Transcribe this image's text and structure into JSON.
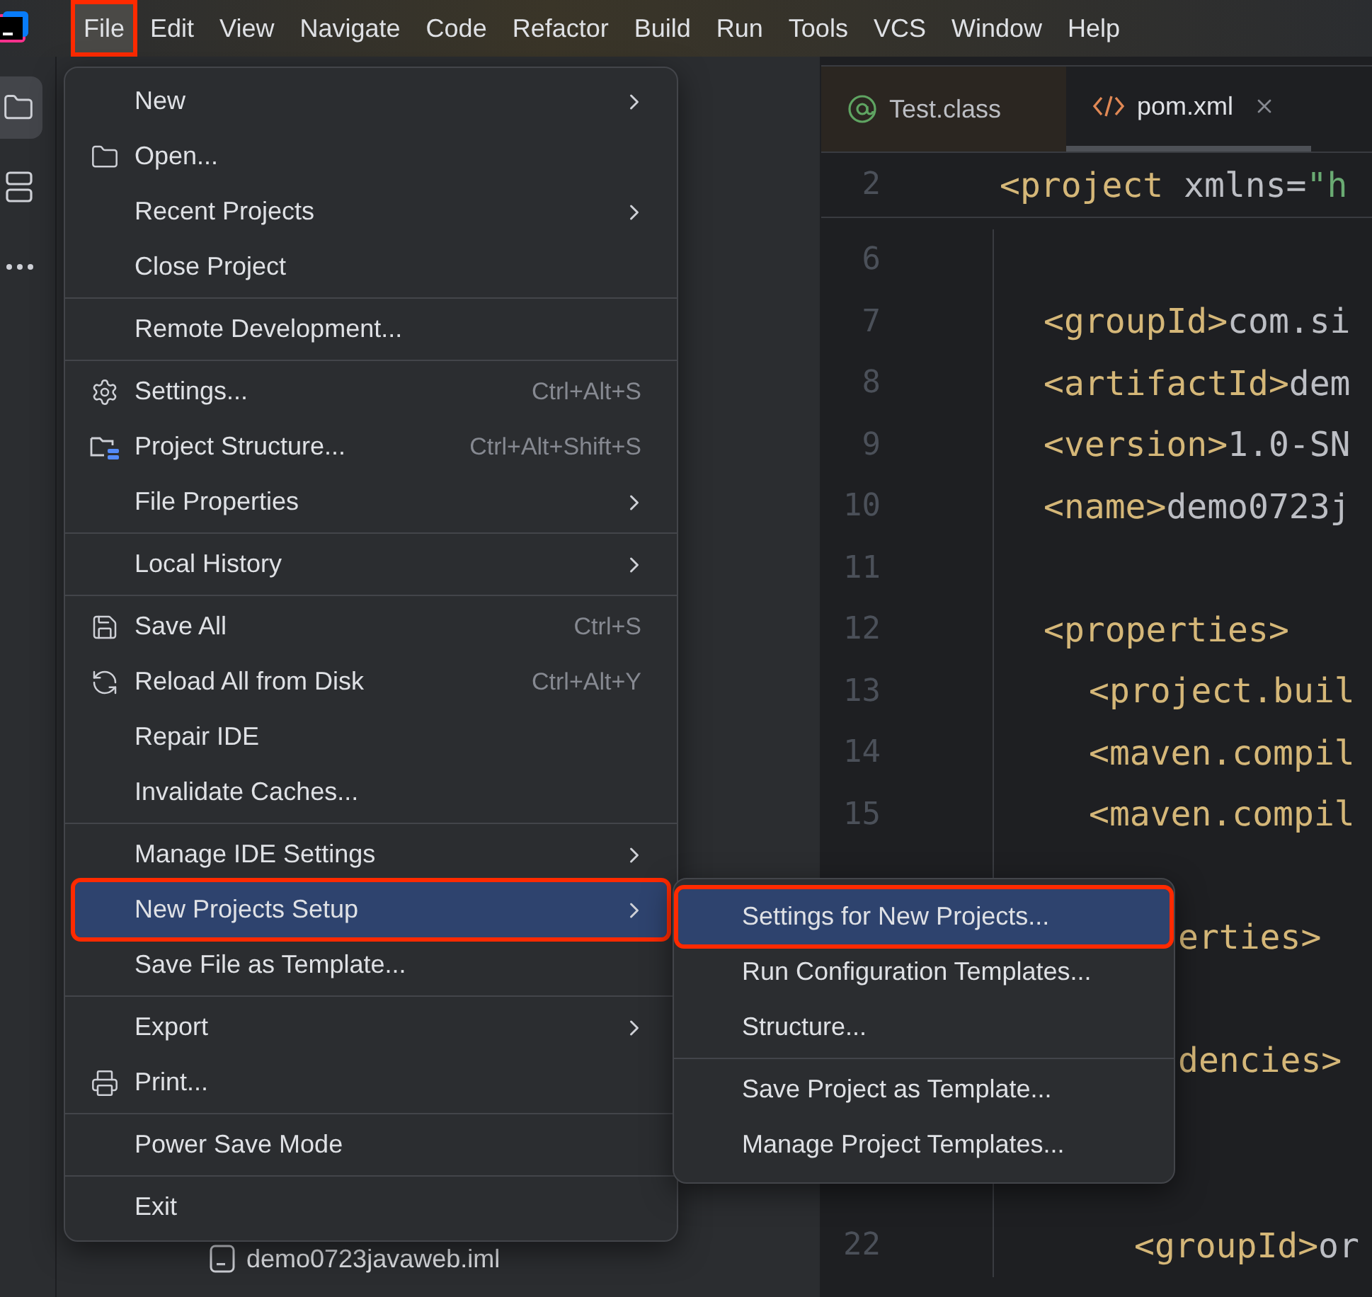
{
  "menubar": [
    {
      "label": "File",
      "selected": true,
      "annotated": true
    },
    {
      "label": "Edit",
      "selected": false,
      "annotated": false
    },
    {
      "label": "View",
      "selected": false,
      "annotated": false
    },
    {
      "label": "Navigate",
      "selected": false,
      "annotated": false
    },
    {
      "label": "Code",
      "selected": false,
      "annotated": false
    },
    {
      "label": "Refactor",
      "selected": false,
      "annotated": false
    },
    {
      "label": "Build",
      "selected": false,
      "annotated": false
    },
    {
      "label": "Run",
      "selected": false,
      "annotated": false
    },
    {
      "label": "Tools",
      "selected": false,
      "annotated": false
    },
    {
      "label": "VCS",
      "selected": false,
      "annotated": false
    },
    {
      "label": "Window",
      "selected": false,
      "annotated": false
    },
    {
      "label": "Help",
      "selected": false,
      "annotated": false
    }
  ],
  "tool_strip": [
    {
      "selected": true
    },
    {
      "selected": false
    },
    {
      "selected": false
    }
  ],
  "project_tree": [
    {
      "label": "demo0723javaweb.iml"
    }
  ],
  "editor": {
    "tabs": [
      {
        "label": "Test.class",
        "kind": "class",
        "selected": false,
        "closable": false
      },
      {
        "label": "pom.xml",
        "kind": "xml",
        "selected": true,
        "closable": true
      }
    ],
    "sticky_line": {
      "number": "2",
      "segments": [
        {
          "kind": "tag",
          "text": "<project"
        },
        {
          "kind": "attr",
          "text": " xmlns="
        },
        {
          "kind": "string",
          "text": "\"h"
        }
      ]
    },
    "lines": [
      {
        "kind": "code",
        "number": "6"
      },
      {
        "kind": "code",
        "number": "7",
        "segments": [
          {
            "kind": "tag",
            "text": "<groupId>"
          },
          {
            "kind": "text",
            "text": "com.si"
          }
        ]
      },
      {
        "kind": "code",
        "number": "8",
        "segments": [
          {
            "kind": "tag",
            "text": "<artifactId>"
          },
          {
            "kind": "text",
            "text": "dem"
          }
        ]
      },
      {
        "kind": "code",
        "number": "9",
        "segments": [
          {
            "kind": "tag",
            "text": "<version>"
          },
          {
            "kind": "text",
            "text": "1.0-SN"
          }
        ]
      },
      {
        "kind": "code",
        "number": "10",
        "segments": [
          {
            "kind": "tag",
            "text": "<name>"
          },
          {
            "kind": "text",
            "text": "demo0723j"
          }
        ]
      },
      {
        "kind": "code",
        "number": "11"
      },
      {
        "kind": "code",
        "number": "12",
        "segments": [
          {
            "kind": "tag",
            "text": "<properties>"
          }
        ]
      },
      {
        "kind": "code",
        "number": "13",
        "segments": [
          {
            "kind": "tag",
            "text": "<project.buil"
          }
        ]
      },
      {
        "kind": "code",
        "number": "14",
        "segments": [
          {
            "kind": "tag",
            "text": "<maven.compil"
          }
        ]
      },
      {
        "kind": "code",
        "number": "15",
        "segments": [
          {
            "kind": "tag",
            "text": "<maven.compil"
          }
        ]
      },
      {
        "kind": "blank"
      },
      {
        "kind": "code",
        "segments": [
          {
            "kind": "tag",
            "text": "erties>"
          }
        ]
      },
      {
        "kind": "blank"
      },
      {
        "kind": "code",
        "segments": [
          {
            "kind": "tag",
            "text": "dencies>"
          }
        ]
      },
      {
        "kind": "blank"
      },
      {
        "kind": "blank"
      },
      {
        "kind": "code",
        "number": "22",
        "segments": [
          {
            "kind": "tag",
            "text": "<groupId>"
          },
          {
            "kind": "text",
            "text": "or"
          }
        ]
      }
    ]
  },
  "file_menu": {
    "groups": [
      [
        {
          "label": "New",
          "submenu": true,
          "selected": false,
          "annotated": false
        },
        {
          "label": "Open...",
          "submenu": false,
          "selected": false,
          "annotated": false
        },
        {
          "label": "Recent Projects",
          "submenu": true,
          "selected": false,
          "annotated": false
        },
        {
          "label": "Close Project",
          "submenu": false,
          "selected": false,
          "annotated": false
        }
      ],
      [
        {
          "label": "Remote Development...",
          "submenu": false,
          "selected": false,
          "annotated": false
        }
      ],
      [
        {
          "label": "Settings...",
          "shortcut": "Ctrl+Alt+S",
          "submenu": false,
          "selected": false,
          "annotated": false
        },
        {
          "label": "Project Structure...",
          "shortcut": "Ctrl+Alt+Shift+S",
          "submenu": false,
          "selected": false,
          "annotated": false
        },
        {
          "label": "File Properties",
          "submenu": true,
          "selected": false,
          "annotated": false
        }
      ],
      [
        {
          "label": "Local History",
          "submenu": true,
          "selected": false,
          "annotated": false
        }
      ],
      [
        {
          "label": "Save All",
          "shortcut": "Ctrl+S",
          "submenu": false,
          "selected": false,
          "annotated": false
        },
        {
          "label": "Reload All from Disk",
          "shortcut": "Ctrl+Alt+Y",
          "submenu": false,
          "selected": false,
          "annotated": false
        },
        {
          "label": "Repair IDE",
          "submenu": false,
          "selected": false,
          "annotated": false
        },
        {
          "label": "Invalidate Caches...",
          "submenu": false,
          "selected": false,
          "annotated": false
        }
      ],
      [
        {
          "label": "Manage IDE Settings",
          "submenu": true,
          "selected": false,
          "annotated": false
        },
        {
          "label": "New Projects Setup",
          "submenu": true,
          "selected": true,
          "annotated": true
        },
        {
          "label": "Save File as Template...",
          "submenu": false,
          "selected": false,
          "annotated": false
        }
      ],
      [
        {
          "label": "Export",
          "submenu": true,
          "selected": false,
          "annotated": false
        },
        {
          "label": "Print...",
          "submenu": false,
          "selected": false,
          "annotated": false
        }
      ],
      [
        {
          "label": "Power Save Mode",
          "submenu": false,
          "selected": false,
          "annotated": false
        }
      ],
      [
        {
          "label": "Exit",
          "submenu": false,
          "selected": false,
          "annotated": false
        }
      ]
    ]
  },
  "new_projects_setup_menu": {
    "groups": [
      [
        {
          "label": "Settings for New Projects...",
          "selected": true,
          "annotated": true
        },
        {
          "label": "Run Configuration Templates...",
          "selected": false,
          "annotated": false
        },
        {
          "label": "Structure...",
          "selected": false,
          "annotated": false
        }
      ],
      [
        {
          "label": "Save Project as Template...",
          "selected": false,
          "annotated": false
        },
        {
          "label": "Manage Project Templates...",
          "selected": false,
          "annotated": false
        }
      ]
    ]
  }
}
